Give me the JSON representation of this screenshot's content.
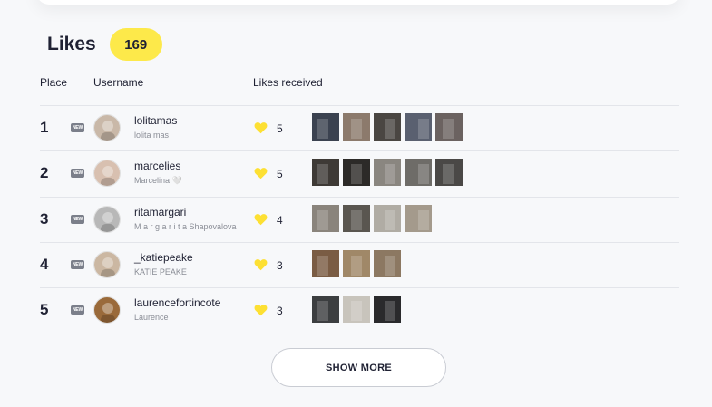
{
  "section": {
    "title": "Likes",
    "total": "169"
  },
  "columns": {
    "place": "Place",
    "username": "Username",
    "likes_received": "Likes received"
  },
  "new_label": "NEW",
  "colors": {
    "badge": "#fde94a",
    "heart": "#fde033",
    "new_tag": "#7b7f8a"
  },
  "rows": [
    {
      "place": "1",
      "username": "lolitamas",
      "full_name": "lolita mas",
      "likes": "5",
      "avatar": "#c9b8a8",
      "thumbs": [
        "#3b4250",
        "#8c7a6c",
        "#4a4642",
        "#5a6070",
        "#6b6260"
      ]
    },
    {
      "place": "2",
      "username": "marcelies",
      "full_name": "Marcelina 🤍",
      "likes": "5",
      "avatar": "#d8c0b0",
      "thumbs": [
        "#3e3a36",
        "#2c2a28",
        "#8a8680",
        "#6e6c68",
        "#4a4846"
      ]
    },
    {
      "place": "3",
      "username": "ritamargari",
      "full_name": "M a r g a r i t a Shapovalova",
      "likes": "4",
      "avatar": "#b8b8b8",
      "thumbs": [
        "#8a847c",
        "#5a5650",
        "#b0aca4",
        "#a49a8c"
      ]
    },
    {
      "place": "4",
      "username": "_katiepeake",
      "full_name": "KATIE PEAKE",
      "likes": "3",
      "avatar": "#cbb7a2",
      "thumbs": [
        "#7a5c44",
        "#a08868",
        "#8c7862"
      ]
    },
    {
      "place": "5",
      "username": "laurencefortincote",
      "full_name": "Laurence",
      "likes": "3",
      "avatar": "#9a6a3a",
      "thumbs": [
        "#3c3e40",
        "#c8c4bc",
        "#2a2a2c"
      ]
    }
  ],
  "show_more": "SHOW MORE"
}
